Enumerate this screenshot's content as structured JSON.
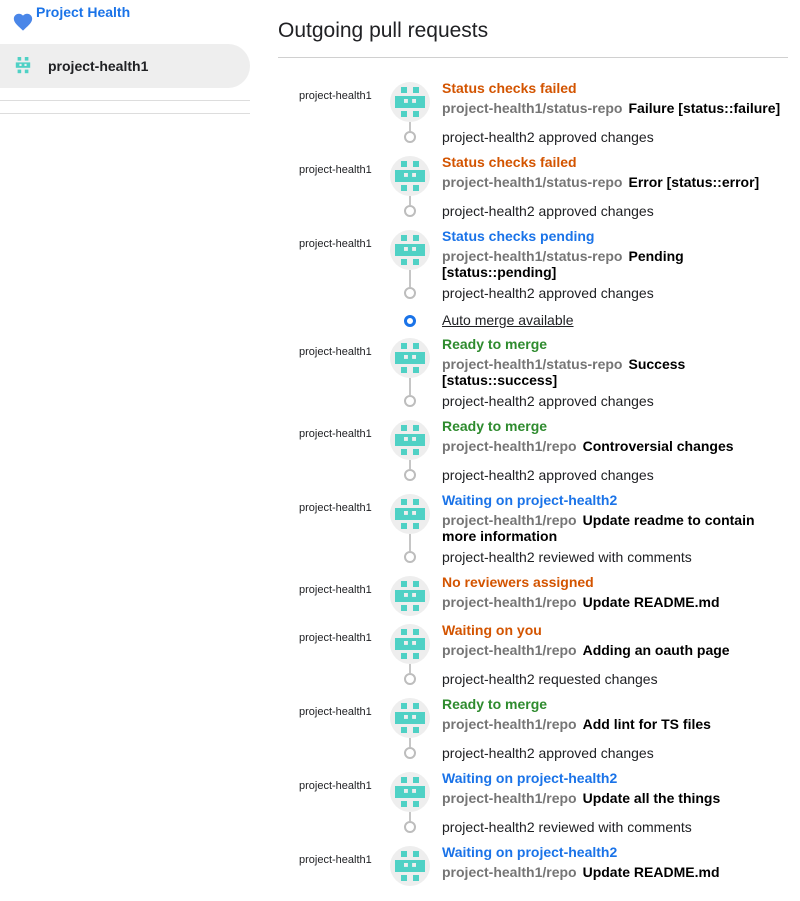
{
  "sidebar": {
    "brand": "Project Health",
    "user": "project-health1"
  },
  "main": {
    "title": "Outgoing pull requests",
    "auto_merge_label": "Auto merge available"
  },
  "colors": {
    "accent": "#1a73e8",
    "status_failed": "#d35400",
    "status_ready": "#2e8b2e",
    "avatar": "#4fd1c5"
  },
  "prs": [
    {
      "author": "project-health1",
      "status": "Status checks failed",
      "repo": "project-health1/status-repo",
      "title": "Failure [status::failure]",
      "review": "project-health2 approved changes"
    },
    {
      "author": "project-health1",
      "status": "Status checks failed",
      "repo": "project-health1/status-repo",
      "title": "Error [status::error]",
      "review": "project-health2 approved changes"
    },
    {
      "author": "project-health1",
      "status": "Status checks pending",
      "repo": "project-health1/status-repo",
      "title": "Pending [status::pending]",
      "review": "project-health2 approved changes"
    },
    {
      "author": "project-health1",
      "status": "Ready to merge",
      "repo": "project-health1/status-repo",
      "title": "Success [status::success]",
      "review": "project-health2 approved changes"
    },
    {
      "author": "project-health1",
      "status": "Ready to merge",
      "repo": "project-health1/repo",
      "title": "Controversial changes",
      "review": "project-health2 approved changes"
    },
    {
      "author": "project-health1",
      "status": "Waiting on project-health2",
      "repo": "project-health1/repo",
      "title": "Update readme to contain more information",
      "review": "project-health2 reviewed with comments"
    },
    {
      "author": "project-health1",
      "status": "No reviewers assigned",
      "repo": "project-health1/repo",
      "title": "Update README.md",
      "review": ""
    },
    {
      "author": "project-health1",
      "status": "Waiting on you",
      "repo": "project-health1/repo",
      "title": "Adding an oauth page",
      "review": "project-health2 requested changes"
    },
    {
      "author": "project-health1",
      "status": "Ready to merge",
      "repo": "project-health1/repo",
      "title": "Add lint for TS files",
      "review": "project-health2 approved changes"
    },
    {
      "author": "project-health1",
      "status": "Waiting on project-health2",
      "repo": "project-health1/repo",
      "title": "Update all the things",
      "review": "project-health2 reviewed with comments"
    },
    {
      "author": "project-health1",
      "status": "Waiting on project-health2",
      "repo": "project-health1/repo",
      "title": "Update README.md",
      "review": ""
    }
  ]
}
